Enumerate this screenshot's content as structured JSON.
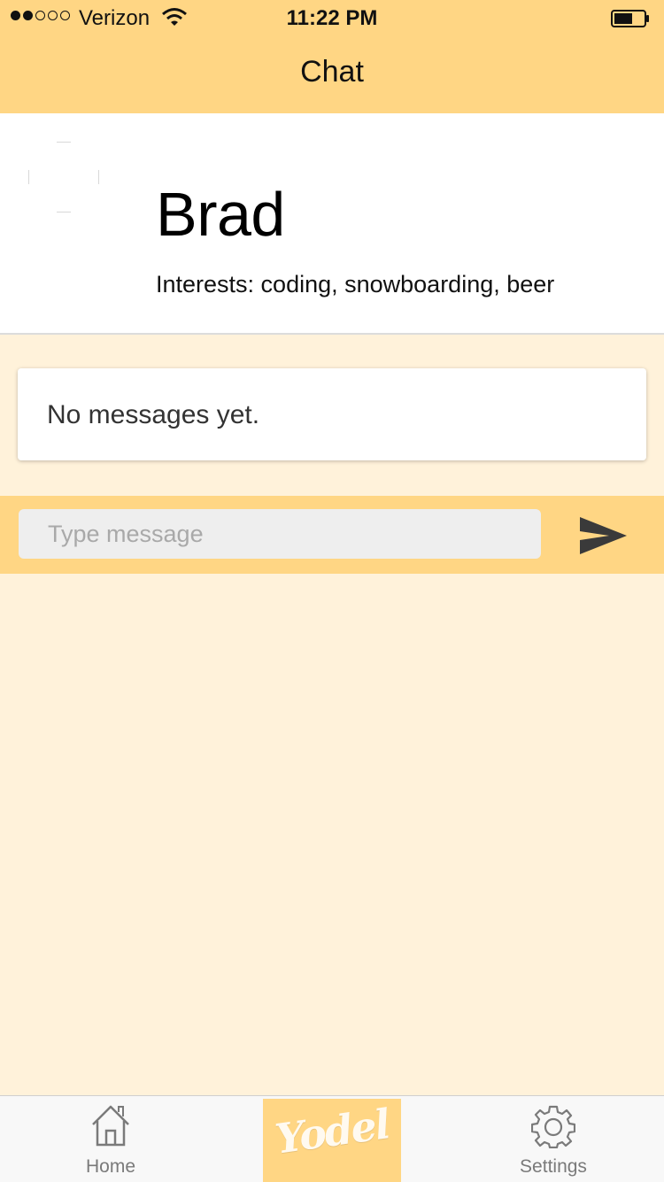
{
  "status_bar": {
    "carrier": "Verizon",
    "time": "11:22 PM",
    "signal_bars_filled": 2,
    "signal_bars_total": 5,
    "battery_level": 0.55
  },
  "nav": {
    "title": "Chat"
  },
  "profile": {
    "name": "Brad",
    "interests": "Interests: coding, snowboarding, beer"
  },
  "messages": {
    "empty_text": "No messages yet."
  },
  "composer": {
    "placeholder": "Type message",
    "value": ""
  },
  "tabbar": {
    "home_label": "Home",
    "logo_text": "Yodel",
    "settings_label": "Settings"
  },
  "colors": {
    "accent": "#ffd684",
    "background": "#fff2da",
    "send_icon": "#3a3a3a"
  },
  "icons": [
    "signal-dots",
    "wifi-icon",
    "battery-icon",
    "avatar-placeholder",
    "send-icon",
    "home-icon",
    "gear-icon"
  ]
}
